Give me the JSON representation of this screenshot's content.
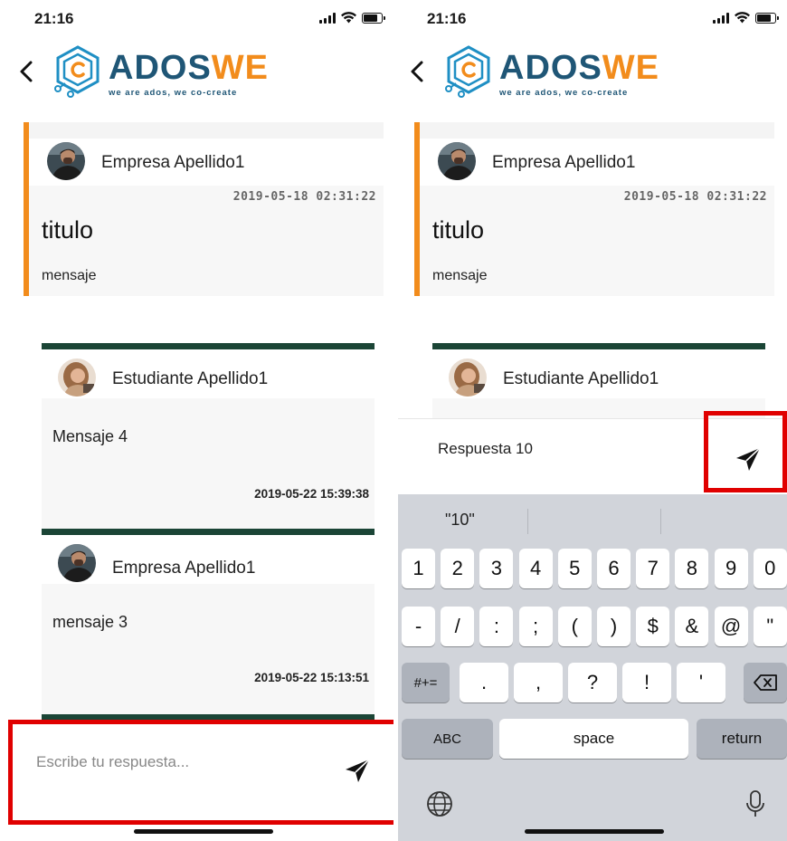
{
  "status_bar": {
    "time": "21:16"
  },
  "logo": {
    "brand_part1": "ADOS",
    "brand_part2": "WE",
    "tagline": "we are ados, we co-create"
  },
  "post": {
    "author": "Empresa Apellido1",
    "date": "2019-05-18 02:31:22",
    "title": "titulo",
    "message": "mensaje"
  },
  "replies": [
    {
      "author": "Estudiante Apellido1",
      "message": "Mensaje 4",
      "date": "2019-05-22 15:39:38"
    },
    {
      "author": "Empresa Apellido1",
      "message": "mensaje 3",
      "date": "2019-05-22 15:13:51"
    }
  ],
  "response": {
    "placeholder": "Escribe tu respuesta...",
    "typed_value": "Respuesta 10"
  },
  "keyboard": {
    "suggestion": "\"10\"",
    "row1": [
      "1",
      "2",
      "3",
      "4",
      "5",
      "6",
      "7",
      "8",
      "9",
      "0"
    ],
    "row2": [
      "-",
      "/",
      ":",
      ";",
      "(",
      ")",
      "$",
      "&",
      "@",
      "\""
    ],
    "row3": [
      ".",
      ",",
      "?",
      "!",
      "'"
    ],
    "symbols_label": "#+=",
    "abc_label": "ABC",
    "space_label": "space",
    "return_label": "return"
  },
  "colors": {
    "accent_orange": "#f28c1c",
    "brand_blue": "#1f5676",
    "reply_border": "#1b4536",
    "highlight_red": "#e00000"
  }
}
